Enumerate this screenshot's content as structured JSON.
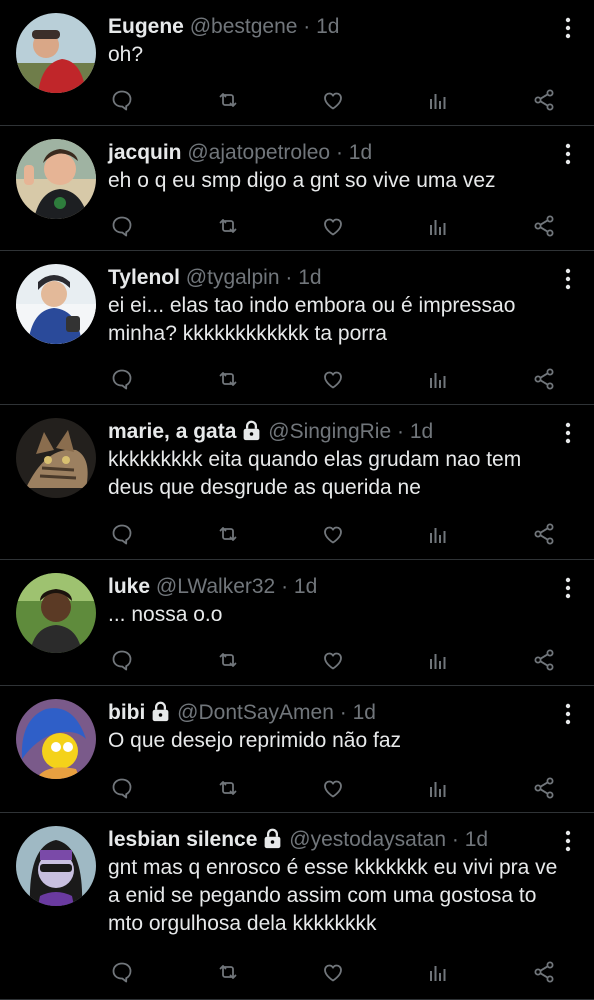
{
  "tweets": [
    {
      "name": "Eugene",
      "handle": "@bestgene",
      "time": "1d",
      "locked": false,
      "text": "oh?"
    },
    {
      "name": "jacquin",
      "handle": "@ajatopetroleo",
      "time": "1d",
      "locked": false,
      "text": "eh o q eu smp digo a gnt so vive uma vez"
    },
    {
      "name": "Tylenol",
      "handle": "@tygalpin",
      "time": "1d",
      "locked": false,
      "text": "ei ei... elas tao indo embora ou é impressao minha? kkkkkkkkkkkk ta porra"
    },
    {
      "name": "marie, a gata",
      "handle": "@SingingRie",
      "time": "1d",
      "locked": true,
      "text": "kkkkkkkkk eita quando elas grudam nao tem deus que desgrude as querida ne"
    },
    {
      "name": "luke",
      "handle": "@LWalker32",
      "time": "1d",
      "locked": false,
      "text": "... nossa o.o"
    },
    {
      "name": "bibi",
      "handle": "@DontSayAmen",
      "time": "1d",
      "locked": true,
      "text": "O que desejo reprimido não faz"
    },
    {
      "name": "lesbian silence",
      "handle": "@yestodaysatan",
      "time": "1d",
      "locked": true,
      "text": "gnt mas q enrosco é esse kkkkkkk eu vivi pra ve a enid se pegando assim com uma gostosa to mto orgulhosa dela kkkkkkkk"
    }
  ],
  "separator": "·",
  "icons": {
    "reply": "reply-icon",
    "retweet": "retweet-icon",
    "like": "heart-icon",
    "views": "analytics-icon",
    "share": "share-icon",
    "more": "more-vertical-icon",
    "lock": "lock-icon"
  },
  "colors": {
    "background": "#000000",
    "text": "#e7e9ea",
    "muted": "#71767b",
    "divider": "#2f3336"
  }
}
